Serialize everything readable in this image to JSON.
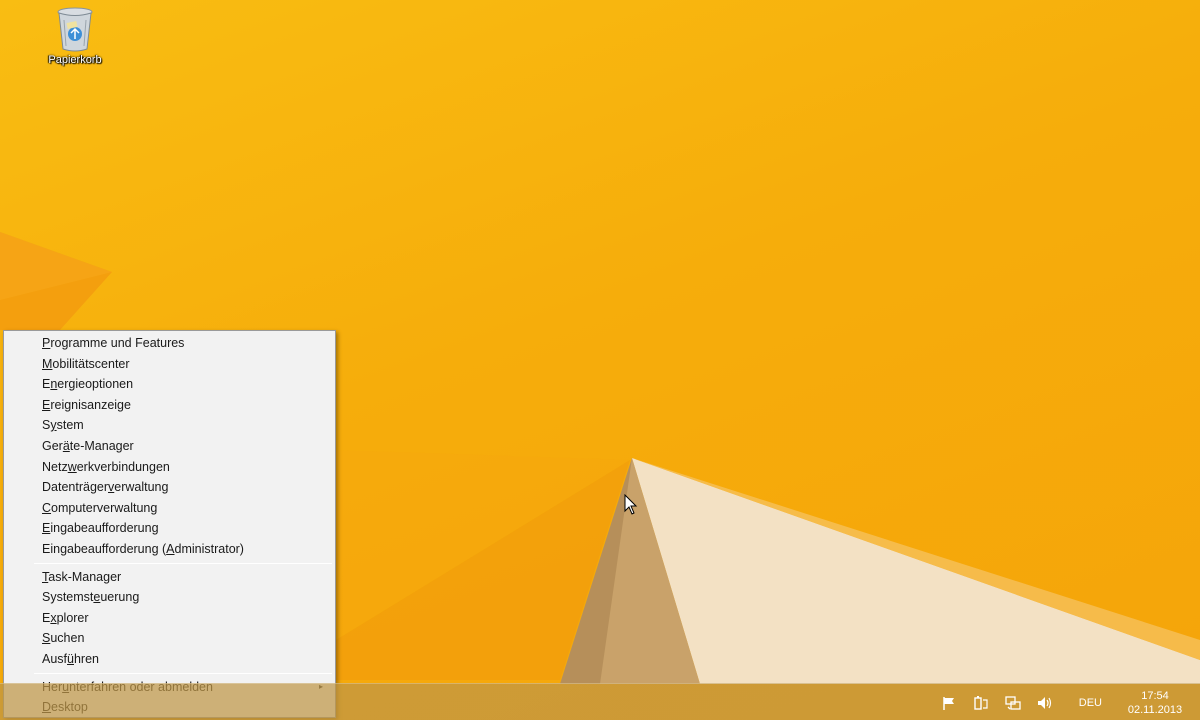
{
  "desktop": {
    "icons": [
      {
        "label": "Papierkorb",
        "icon": "recycle-bin-icon"
      }
    ]
  },
  "context_menu": {
    "groups": [
      [
        {
          "pre": "",
          "acc": "P",
          "post": "rogramme und Features"
        },
        {
          "pre": "",
          "acc": "M",
          "post": "obilitätscenter"
        },
        {
          "pre": "E",
          "acc": "n",
          "post": "ergieoptionen"
        },
        {
          "pre": "",
          "acc": "E",
          "post": "reignisanzeige"
        },
        {
          "pre": "S",
          "acc": "y",
          "post": "stem"
        },
        {
          "pre": "Ger",
          "acc": "ä",
          "post": "te-Manager"
        },
        {
          "pre": "Netz",
          "acc": "w",
          "post": "erkverbindungen"
        },
        {
          "pre": "Datenträger",
          "acc": "v",
          "post": "erwaltung"
        },
        {
          "pre": "",
          "acc": "C",
          "post": "omputerverwaltung"
        },
        {
          "pre": "",
          "acc": "E",
          "post": "ingabeaufforderung"
        },
        {
          "pre": "Eingabeaufforderung (",
          "acc": "A",
          "post": "dministrator)"
        }
      ],
      [
        {
          "pre": "",
          "acc": "T",
          "post": "ask-Manager"
        },
        {
          "pre": "Systemst",
          "acc": "e",
          "post": "uerung"
        },
        {
          "pre": "E",
          "acc": "x",
          "post": "plorer"
        },
        {
          "pre": "",
          "acc": "S",
          "post": "uchen"
        },
        {
          "pre": "Ausf",
          "acc": "ü",
          "post": "hren"
        }
      ],
      [
        {
          "pre": "Her",
          "acc": "u",
          "post": "nterfahren oder abmelden",
          "submenu": true
        },
        {
          "pre": "",
          "acc": "D",
          "post": "esktop"
        }
      ]
    ],
    "submenu_arrow": "▸"
  },
  "taskbar": {
    "tray_icons": [
      "action-center-flag-icon",
      "power-battery-icon",
      "network-icon",
      "volume-icon"
    ],
    "language": "DEU",
    "time": "17:54",
    "date": "02.11.2013"
  },
  "colors": {
    "wallpaper": "#f7b40d",
    "menu_bg": "#f2f2f2",
    "taskbar": "#be9646"
  }
}
